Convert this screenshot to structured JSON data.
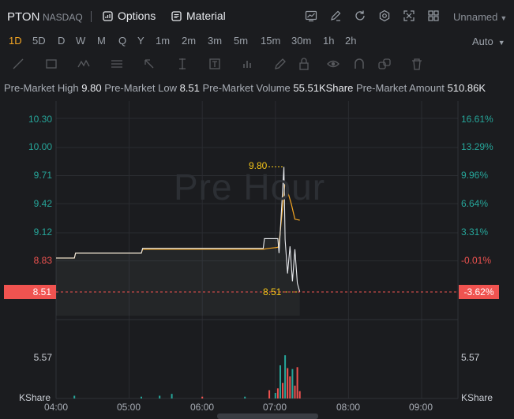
{
  "header": {
    "symbol": "PTON",
    "exchange": "NASDAQ",
    "options_label": "Options",
    "material_label": "Material",
    "layout_name": "Unnamed",
    "icons": [
      "chart-type-icon",
      "draw-icon",
      "refresh-icon",
      "settings-icon",
      "fullscreen-icon",
      "layout-grid-icon"
    ]
  },
  "periods": [
    "1D",
    "5D",
    "D",
    "W",
    "M",
    "Q",
    "Y",
    "1m",
    "2m",
    "3m",
    "5m",
    "15m",
    "30m",
    "1h",
    "2h"
  ],
  "active_period": "1D",
  "auto_label": "Auto",
  "premarket": {
    "high_label": "Pre-Market High",
    "high_value": "9.80",
    "low_label": "Pre-Market Low",
    "low_value": "8.51",
    "volume_label": "Pre-Market Volume",
    "volume_value": "55.51KShare",
    "amount_label": "Pre-Market Amount",
    "amount_value": "510.86K"
  },
  "watermark": "Pre Hour",
  "price_axis_left": [
    "10.30",
    "10.00",
    "9.71",
    "9.42",
    "9.12",
    "8.83"
  ],
  "price_axis_right": [
    "16.61%",
    "13.29%",
    "9.96%",
    "6.64%",
    "3.31%",
    "-0.01%"
  ],
  "current_price": "8.51",
  "current_pct": "-3.62%",
  "high_marker": "9.80",
  "low_marker": "8.51",
  "volume_axis": "5.57",
  "volume_unit": "KShare",
  "time_labels": [
    "04:00",
    "05:00",
    "06:00",
    "07:00",
    "08:00",
    "09:00"
  ],
  "colors": {
    "accent": "#f5a623",
    "up": "#26a69a",
    "down": "#f05350",
    "price_line": "#e8eaee",
    "avg_line": "#f5a623"
  },
  "chart_data": {
    "type": "line",
    "x_axis": [
      "04:00",
      "05:00",
      "06:00",
      "07:00",
      "08:00",
      "09:00"
    ],
    "ylim": [
      8.4,
      10.4
    ],
    "series": [
      {
        "x": [
          "04:00",
          "04:15",
          "04:16",
          "05:10",
          "05:11",
          "06:50",
          "06:51",
          "07:02",
          "07:03",
          "07:07",
          "07:08",
          "07:10",
          "07:12",
          "07:14",
          "07:16",
          "07:18",
          "07:20"
        ],
        "values": [
          8.86,
          8.86,
          8.91,
          8.91,
          8.96,
          8.96,
          9.06,
          9.06,
          8.91,
          9.8,
          9.05,
          8.7,
          8.98,
          8.62,
          8.95,
          8.6,
          8.51
        ]
      },
      {
        "x": [
          "04:00",
          "04:15",
          "04:16",
          "05:10",
          "05:11",
          "06:50",
          "06:55",
          "07:02",
          "07:03",
          "07:06",
          "07:08",
          "07:10",
          "07:13",
          "07:16",
          "07:20"
        ],
        "values": [
          8.86,
          8.86,
          8.91,
          8.91,
          8.95,
          8.95,
          8.96,
          8.97,
          9.0,
          9.4,
          9.65,
          9.55,
          9.42,
          9.26,
          9.25
        ]
      }
    ],
    "volume": {
      "x": [
        "04:15",
        "05:10",
        "05:25",
        "05:35",
        "06:00",
        "06:35",
        "06:55",
        "07:00",
        "07:02",
        "07:04",
        "07:06",
        "07:08",
        "07:10",
        "07:12",
        "07:14",
        "07:16",
        "07:18",
        "07:20"
      ],
      "values": [
        0.3,
        0.2,
        0.3,
        0.5,
        0.2,
        0.2,
        0.9,
        0.6,
        1.1,
        3.6,
        1.7,
        4.7,
        3.3,
        2.4,
        3.2,
        1.4,
        3.4,
        0.8
      ],
      "colors": [
        "up",
        "up",
        "up",
        "up",
        "down",
        "up",
        "down",
        "up",
        "down",
        "up",
        "down",
        "up",
        "down",
        "down",
        "up",
        "down",
        "down",
        "down"
      ]
    }
  }
}
